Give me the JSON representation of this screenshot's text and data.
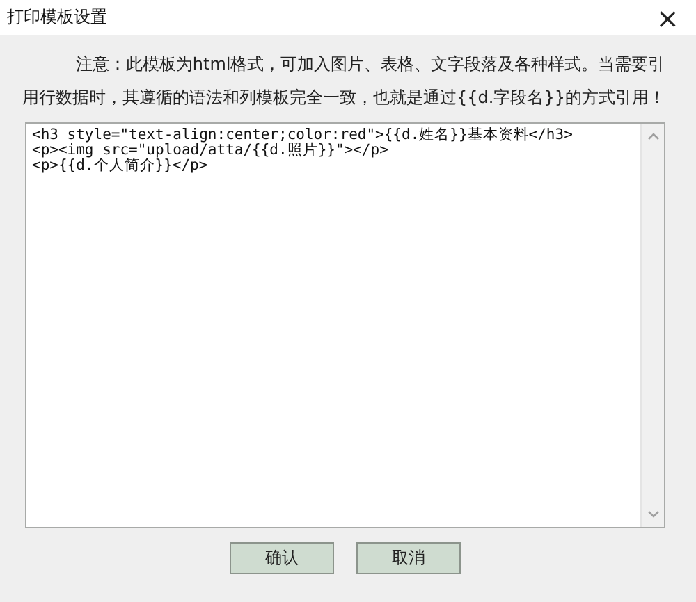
{
  "window": {
    "title": "打印模板设置",
    "close": "×"
  },
  "notice": "注意：此模板为html格式，可加入图片、表格、文字段落及各种样式。当需要引用行数据时，其遵循的语法和列模板完全一致，也就是通过{{d.字段名}}的方式引用！",
  "editor": {
    "lines": [
      "<h3 style=\"text-align:center;color:red\">{{d.姓名}}基本资料</h3>",
      "<p><img src=\"upload/atta/{{d.照片}}\"></p>",
      "<p>{{d.个人简介}}</p>"
    ]
  },
  "buttons": [
    "确认",
    "取消"
  ]
}
